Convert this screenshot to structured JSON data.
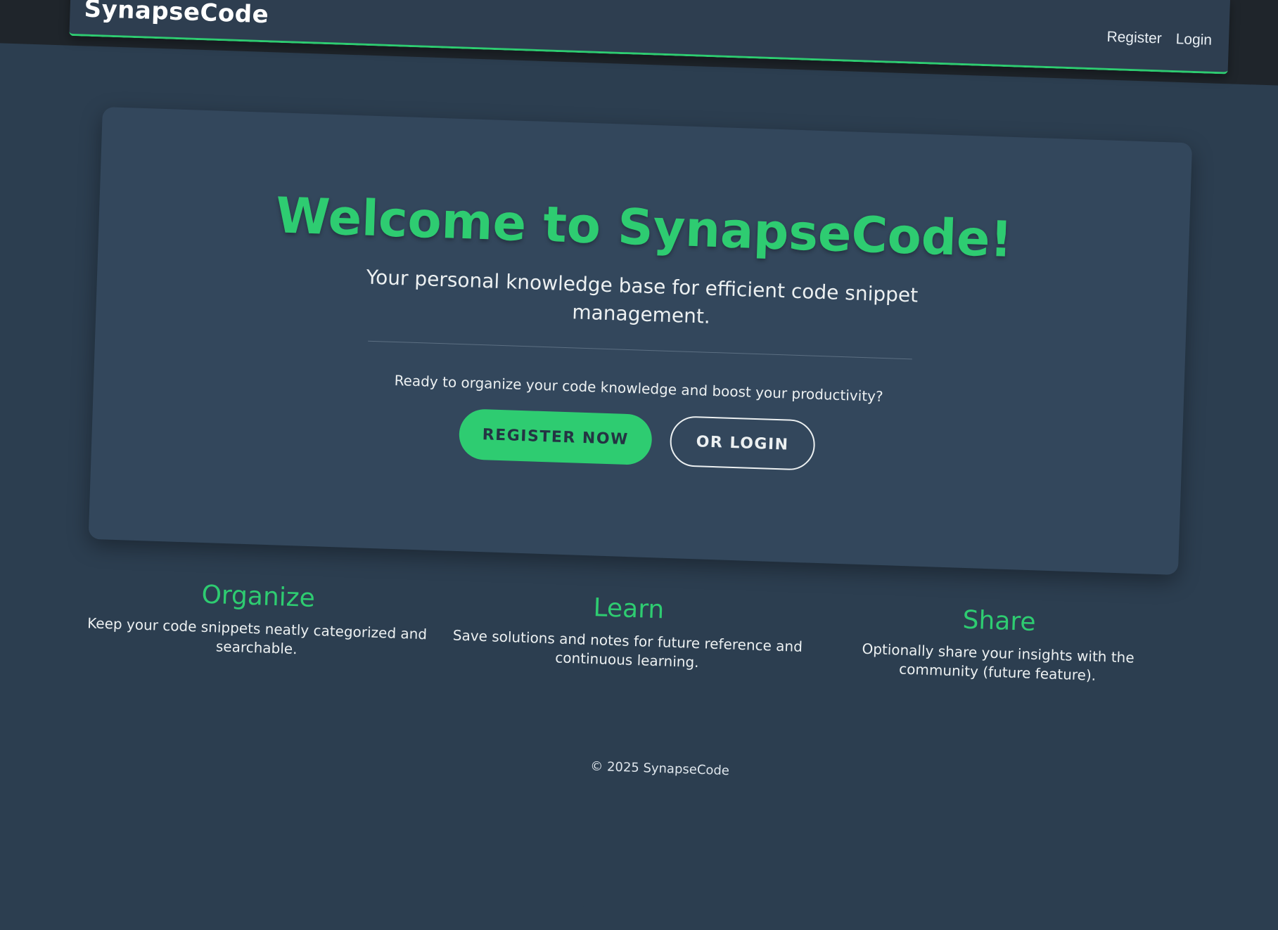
{
  "header": {
    "brand": "SynapseCode",
    "nav": {
      "register": "Register",
      "login": "Login"
    }
  },
  "hero": {
    "title": "Welcome to SynapseCode!",
    "subtitle": "Your personal knowledge base for efficient code snippet management.",
    "cta_text": "Ready to organize your code knowledge and boost your productivity?",
    "register_button": "REGISTER NOW",
    "login_button": "OR LOGIN"
  },
  "features": [
    {
      "title": "Organize",
      "description": "Keep your code snippets neatly categorized and searchable."
    },
    {
      "title": "Learn",
      "description": "Save solutions and notes for future reference and continuous learning."
    },
    {
      "title": "Share",
      "description": "Optionally share your insights with the community (future feature)."
    }
  ],
  "footer": {
    "text": "© 2025 SynapseCode"
  },
  "colors": {
    "accent": "#2ecc71",
    "background": "#2c3e50",
    "card": "#33475c",
    "text": "#ecf0f1"
  }
}
